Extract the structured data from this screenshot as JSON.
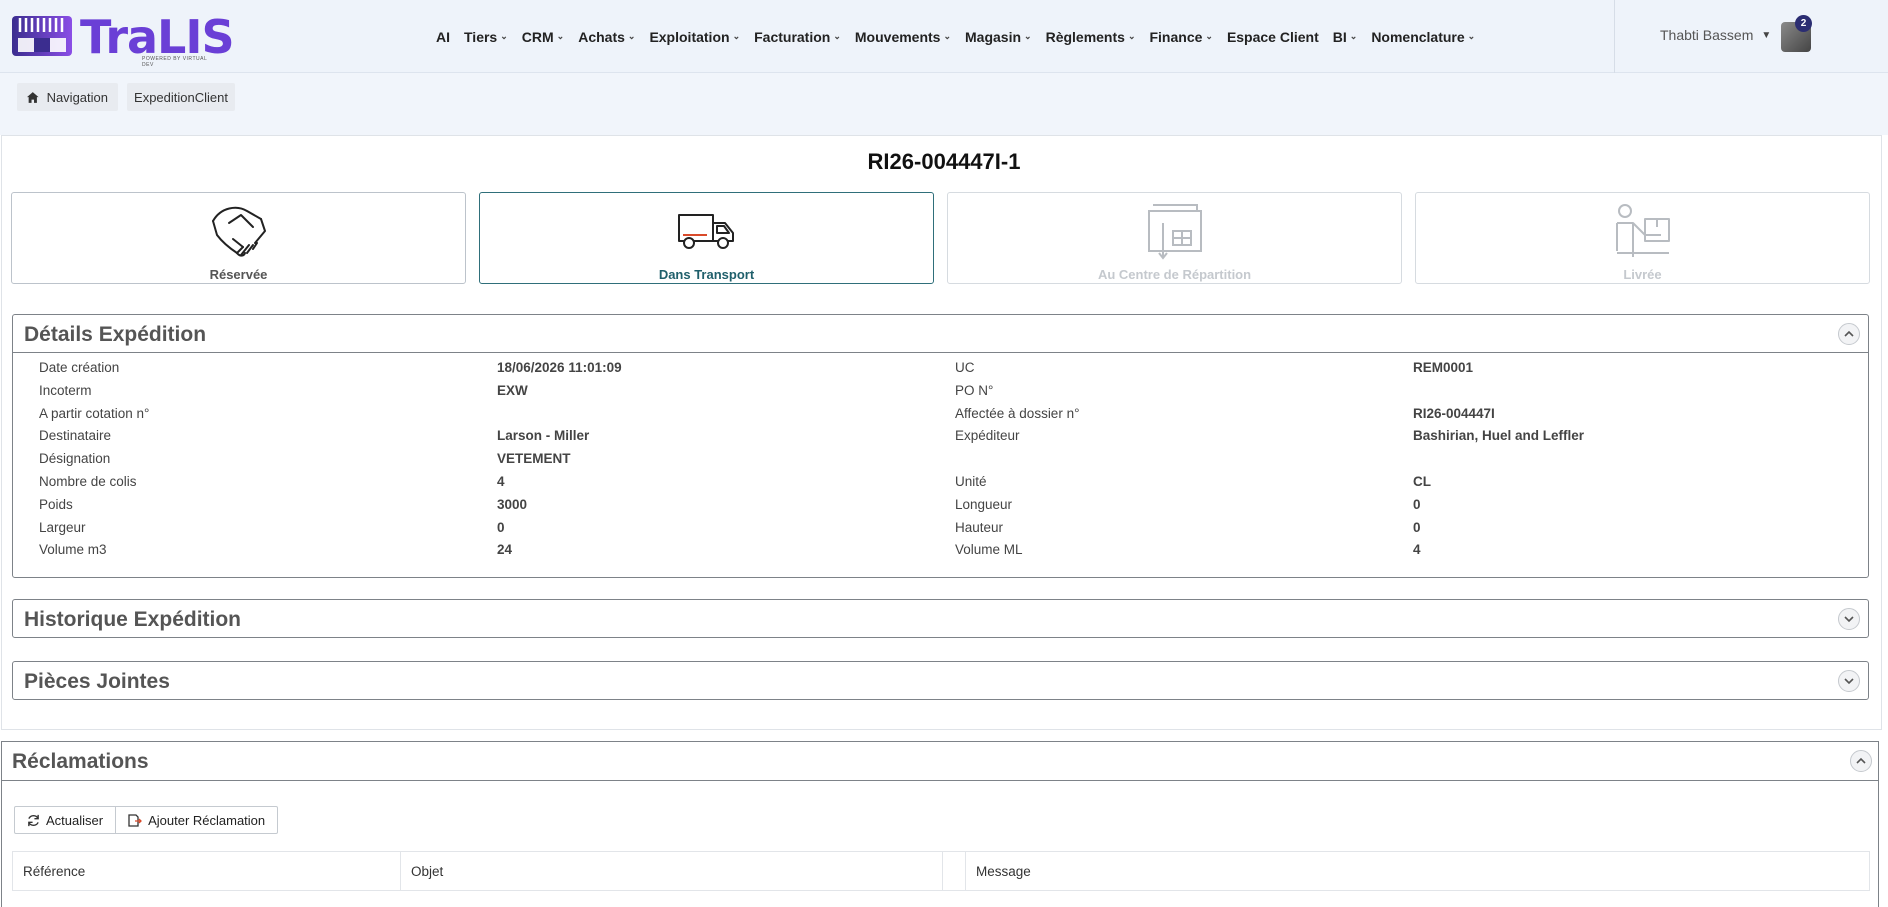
{
  "app": {
    "logo_text": "TraLIS",
    "logo_tagline": "POWERED BY VIRTUAL DEV"
  },
  "nav": [
    {
      "label": "AI",
      "dropdown": false
    },
    {
      "label": "Tiers",
      "dropdown": true
    },
    {
      "label": "CRM",
      "dropdown": true
    },
    {
      "label": "Achats",
      "dropdown": true
    },
    {
      "label": "Exploitation",
      "dropdown": true
    },
    {
      "label": "Facturation",
      "dropdown": true
    },
    {
      "label": "Mouvements",
      "dropdown": true
    },
    {
      "label": "Magasin",
      "dropdown": true
    },
    {
      "label": "Règlements",
      "dropdown": true
    },
    {
      "label": "Finance",
      "dropdown": true
    },
    {
      "label": "Espace Client",
      "dropdown": false
    },
    {
      "label": "BI",
      "dropdown": true
    },
    {
      "label": "Nomenclature",
      "dropdown": true
    }
  ],
  "user": {
    "name": "Thabti Bassem",
    "notifications": "2"
  },
  "breadcrumb": {
    "home": "Navigation",
    "current": "ExpeditionClient"
  },
  "shipment": {
    "reference": "RI26-004447I-1"
  },
  "statuses": [
    {
      "label": "Réservée",
      "icon": "handshake-icon",
      "state": "done"
    },
    {
      "label": "Dans Transport",
      "icon": "truck-icon",
      "state": "active"
    },
    {
      "label": "Au Centre de Répartition",
      "icon": "warehouse-icon",
      "state": "inactive"
    },
    {
      "label": "Livrée",
      "icon": "delivery-person-icon",
      "state": "inactive"
    }
  ],
  "details": {
    "title": "Détails Expédition",
    "left": [
      {
        "label": "Date création",
        "value": "18/06/2026 11:01:09"
      },
      {
        "label": "Incoterm",
        "value": "EXW"
      },
      {
        "label": "A partir cotation n°",
        "value": ""
      },
      {
        "label": "Destinataire",
        "value": "Larson - Miller"
      },
      {
        "label": "Désignation",
        "value": "VETEMENT"
      },
      {
        "label": "Nombre de colis",
        "value": "4"
      },
      {
        "label": "Poids",
        "value": "3000"
      },
      {
        "label": "Largeur",
        "value": "0"
      },
      {
        "label": "Volume m3",
        "value": "24"
      }
    ],
    "right": [
      {
        "label": "UC",
        "value": "REM0001"
      },
      {
        "label": "PO N°",
        "value": ""
      },
      {
        "label": "Affectée à dossier n°",
        "value": "RI26-004447I"
      },
      {
        "label": "Expéditeur",
        "value": "Bashirian, Huel and Leffler"
      },
      {
        "label": "",
        "value": ""
      },
      {
        "label": "Unité",
        "value": "CL"
      },
      {
        "label": "Longueur",
        "value": "0"
      },
      {
        "label": "Hauteur",
        "value": "0"
      },
      {
        "label": "Volume ML",
        "value": "4"
      }
    ]
  },
  "panels": {
    "historique": "Historique Expédition",
    "pieces": "Pièces Jointes"
  },
  "reclamations": {
    "title": "Réclamations",
    "refresh_label": "Actualiser",
    "add_label": "Ajouter Réclamation",
    "columns": [
      "Référence",
      "Objet",
      "",
      "Message"
    ]
  }
}
